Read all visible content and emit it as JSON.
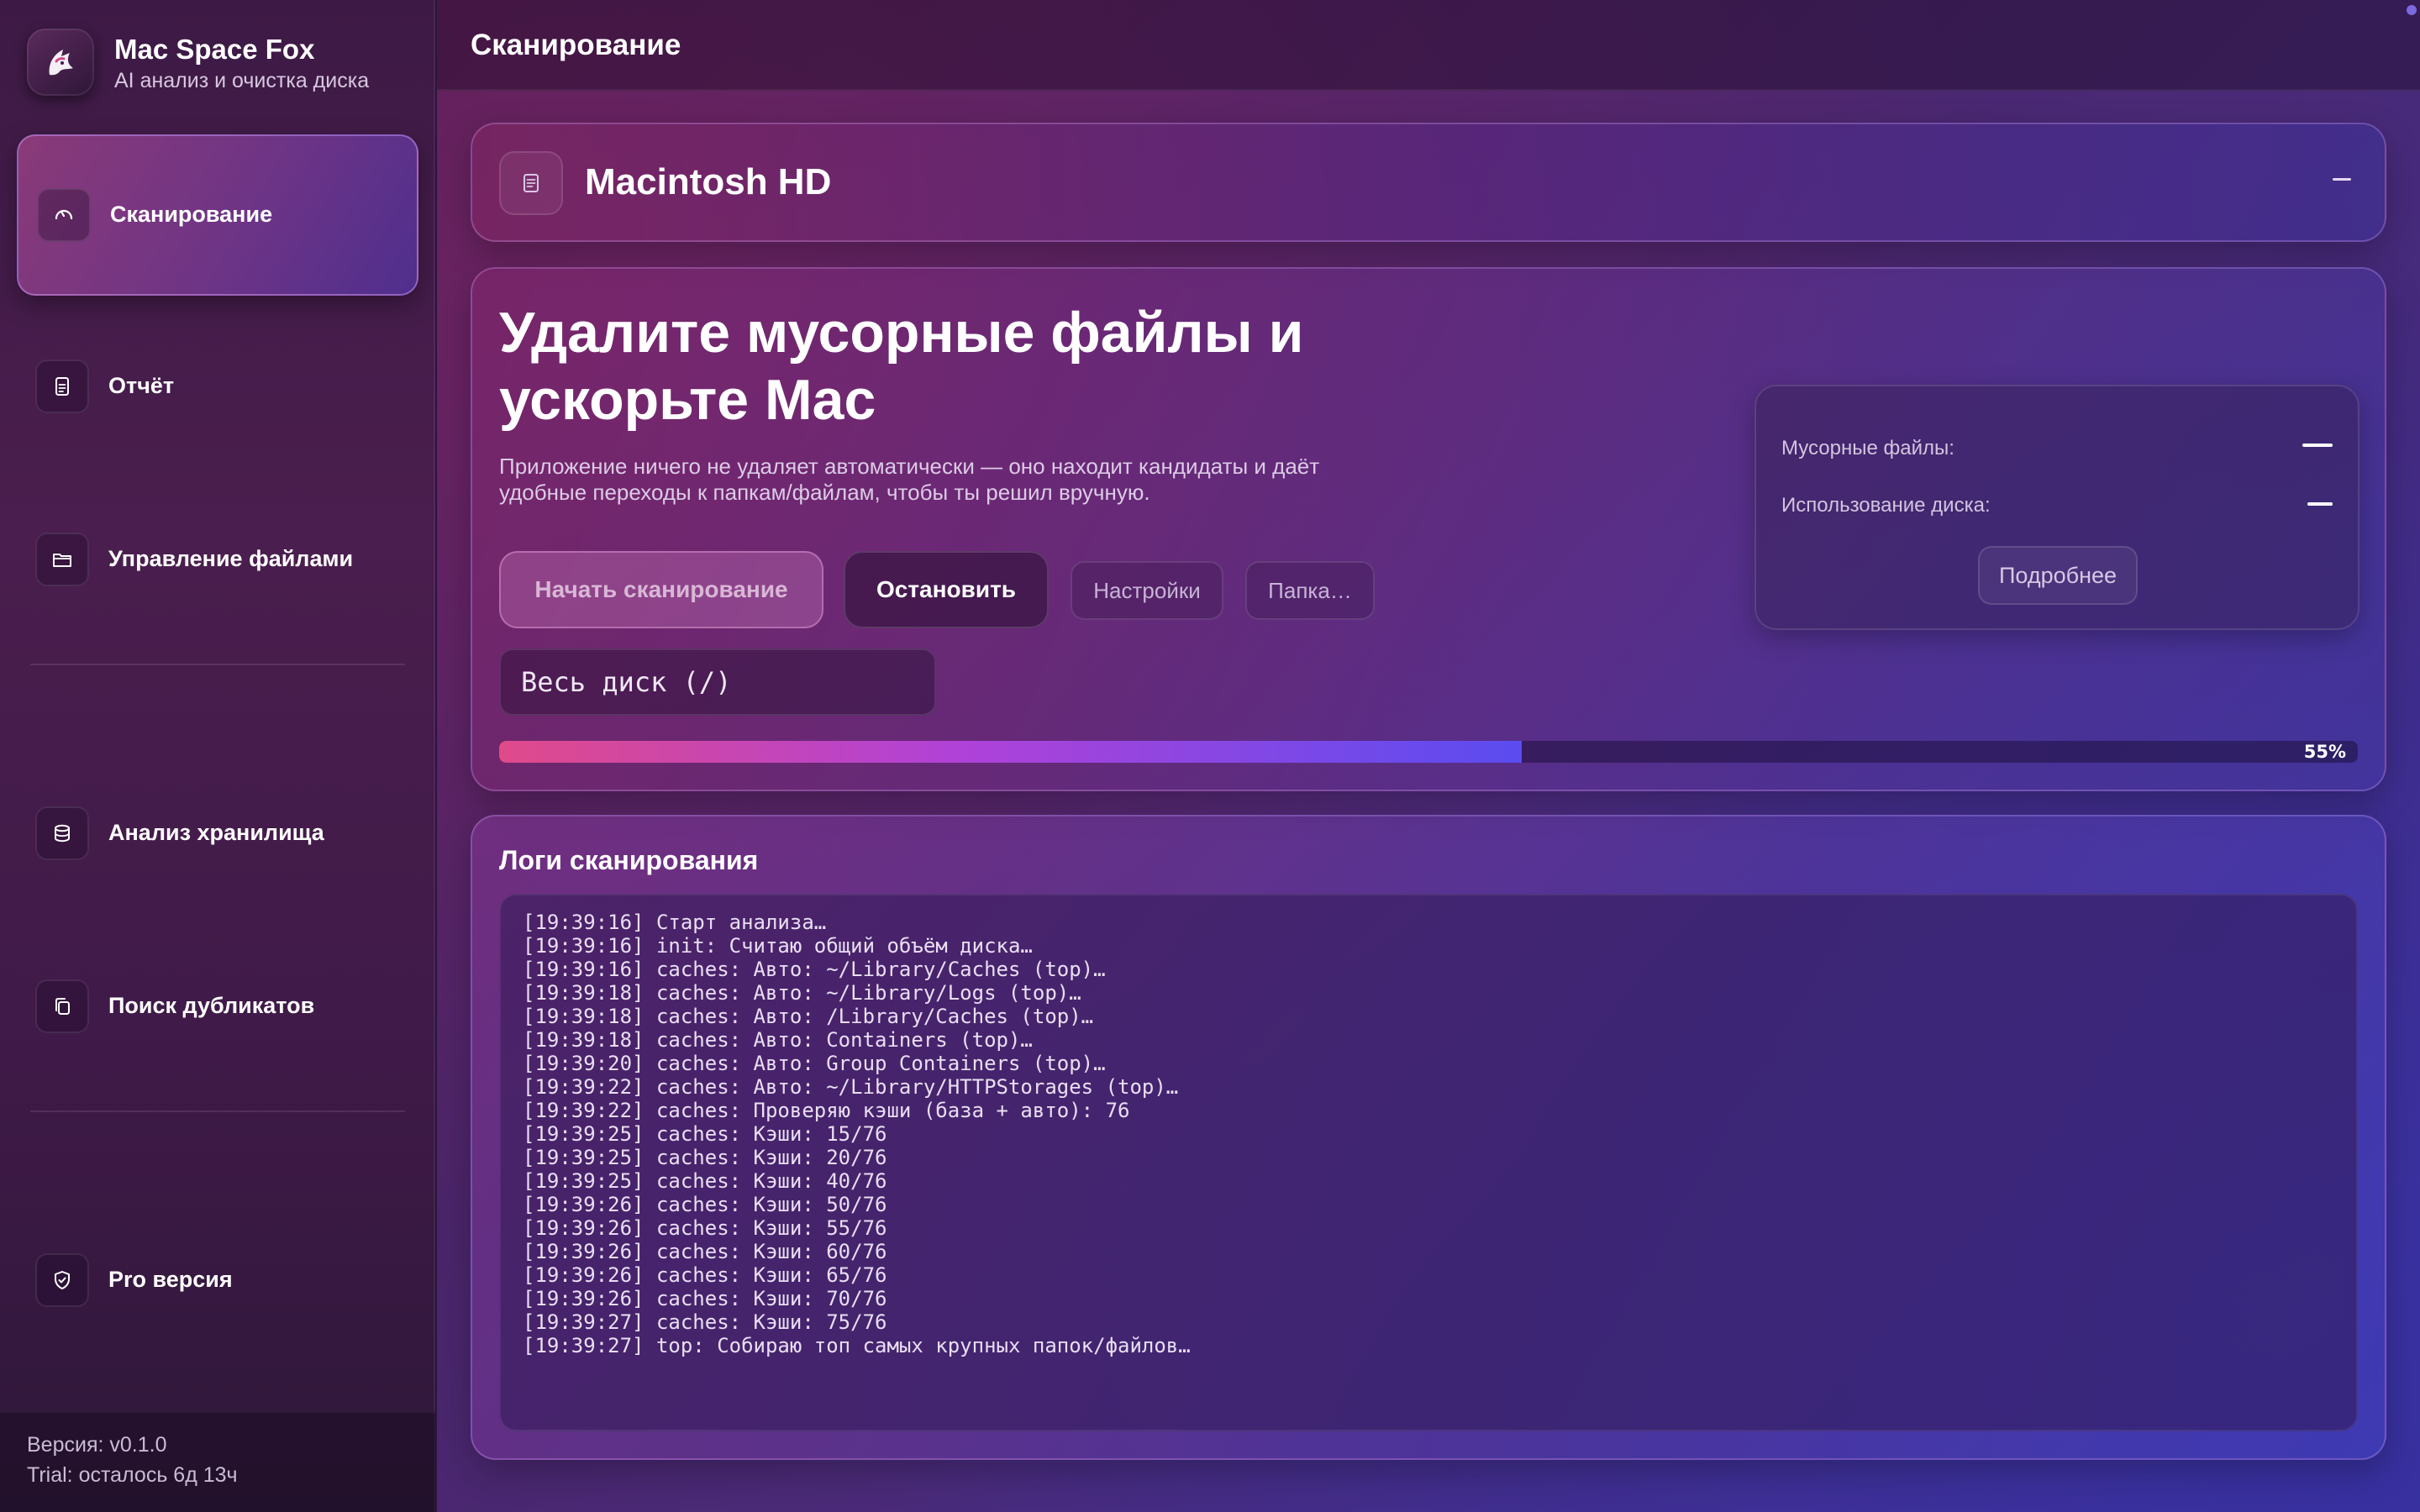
{
  "app": {
    "name": "Mac Space Fox",
    "subtitle": "AI анализ и очистка диска"
  },
  "sidebar": {
    "items": [
      {
        "label": "Сканирование",
        "icon": "gauge-icon",
        "active": true
      },
      {
        "label": "Отчёт",
        "icon": "document-icon"
      },
      {
        "label": "Управление файлами",
        "icon": "folder-icon"
      },
      {
        "label": "Анализ хранилища",
        "icon": "database-icon"
      },
      {
        "label": "Поиск дубликатов",
        "icon": "copy-icon"
      },
      {
        "label": "Pro версия",
        "icon": "shield-check-icon"
      }
    ],
    "version": "Версия: v0.1.0",
    "trial": "Trial: осталось 6д 13ч"
  },
  "header": {
    "title": "Сканирование"
  },
  "disk": {
    "name": "Macintosh HD",
    "collapse_icon": "minus-icon"
  },
  "hero": {
    "title": "Удалите мусорные файлы и ускорьте Mac",
    "description": "Приложение ничего не удаляет автоматически — оно находит кандидаты и даёт удобные переходы к папкам/файлам, чтобы ты решил вручную.",
    "buttons": {
      "start": "Начать сканирование",
      "stop": "Остановить",
      "settings": "Настройки",
      "folder": "Папка…"
    },
    "scan_path": "Весь диск (/)",
    "progress": {
      "value": 55,
      "label": "55%"
    }
  },
  "stats": {
    "junk_label": "Мусорные файлы:",
    "usage_label": "Использование диска:",
    "details_button": "Подробнее"
  },
  "logs": {
    "title": "Логи сканирования",
    "lines": [
      "[19:39:16] Старт анализа…",
      "[19:39:16] init: Считаю общий объём диска…",
      "[19:39:16] caches: Авто: ~/Library/Caches (top)…",
      "[19:39:18] caches: Авто: ~/Library/Logs (top)…",
      "[19:39:18] caches: Авто: /Library/Caches (top)…",
      "[19:39:18] caches: Авто: Containers (top)…",
      "[19:39:20] caches: Авто: Group Containers (top)…",
      "[19:39:22] caches: Авто: ~/Library/HTTPStorages (top)…",
      "[19:39:22] caches: Проверяю кэши (база + авто): 76",
      "[19:39:25] caches: Кэши: 15/76",
      "[19:39:25] caches: Кэши: 20/76",
      "[19:39:25] caches: Кэши: 40/76",
      "[19:39:26] caches: Кэши: 50/76",
      "[19:39:26] caches: Кэши: 55/76",
      "[19:39:26] caches: Кэши: 60/76",
      "[19:39:26] caches: Кэши: 65/76",
      "[19:39:26] caches: Кэши: 70/76",
      "[19:39:27] caches: Кэши: 75/76",
      "[19:39:27] top: Собираю топ самых крупных папок/файлов…"
    ]
  },
  "colors": {
    "accent_pink": "#e04a8a",
    "accent_purple": "#b042d8",
    "accent_blue": "#5a4cf0"
  }
}
